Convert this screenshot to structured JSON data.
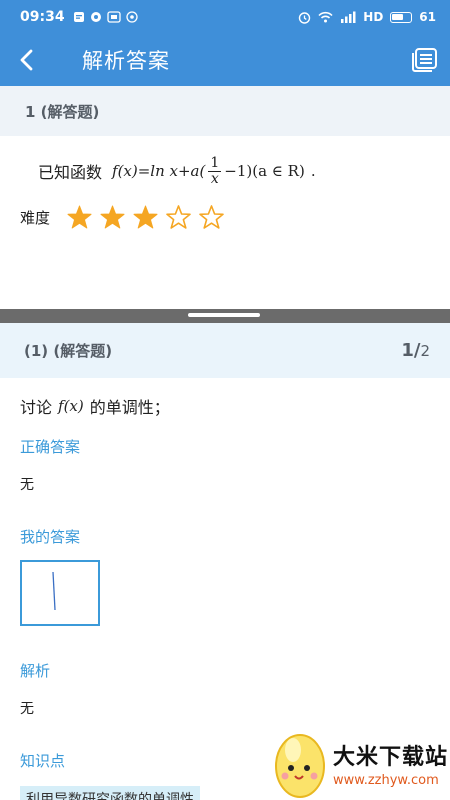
{
  "status_bar": {
    "time": "09:34",
    "network": "HD",
    "battery": "61"
  },
  "app_bar": {
    "title": "解析答案",
    "back_icon": "back-arrow-icon",
    "menu_icon": "list-icon"
  },
  "question": {
    "header": "1 (解答题)",
    "stem_text": "已知函数",
    "formula": {
      "lhs": "f(x)=ln x+a(",
      "frac_num": "1",
      "frac_den": "x",
      "rhs": "−1)(a ∈ R)",
      "end": "."
    },
    "difficulty_label": "难度",
    "difficulty_rating": 3,
    "difficulty_max": 5
  },
  "sub_question": {
    "header": "(1) (解答题)",
    "pager_current": "1/",
    "pager_total": "2",
    "stem_prefix": "讨论",
    "stem_formula": "f(x)",
    "stem_suffix": "的单调性；",
    "correct_answer_title": "正确答案",
    "correct_answer": "无",
    "my_answer_title": "我的答案",
    "analysis_title": "解析",
    "analysis": "无",
    "knowledge_title": "知识点",
    "knowledge_tag": "利用导数研究函数的单调性"
  },
  "watermark": {
    "title": "大米下载站",
    "url": "www.zzhyw.com"
  },
  "colors": {
    "primary": "#3f8fd9",
    "accent_text": "#3b9ad9",
    "star": "#f5a623",
    "header_bg": "#eef3f8"
  }
}
